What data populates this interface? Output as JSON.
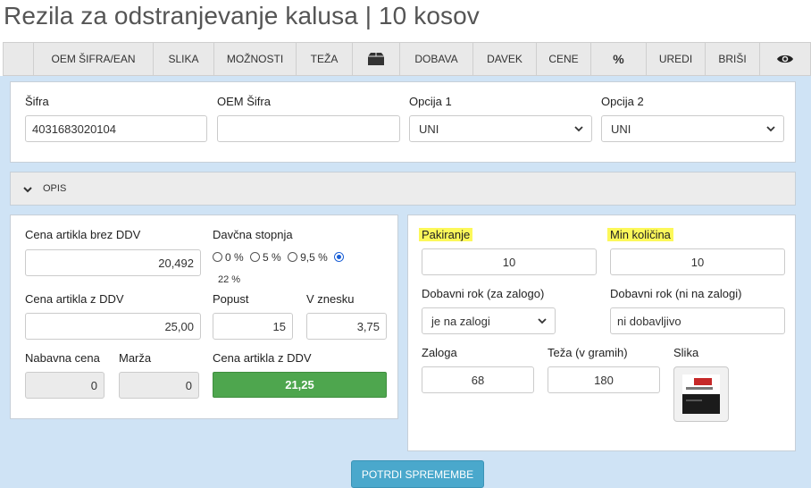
{
  "page": {
    "title": "Rezila za odstranjevanje kalusa | 10 kosov"
  },
  "toolbar": {
    "items": [
      "",
      "OEM ŠIFRA/EAN",
      "SLIKA",
      "MOŽNOSTI",
      "TEŽA",
      "box-icon",
      "DOBAVA",
      "DAVEK",
      "CENE",
      "%",
      "UREDI",
      "BRIŠI",
      "eye-icon"
    ]
  },
  "codes": {
    "sifra_label": "Šifra",
    "sifra_value": "4031683020104",
    "oem_label": "OEM Šifra",
    "oem_value": "",
    "opcija1_label": "Opcija 1",
    "opcija1_value": "UNI",
    "opcija2_label": "Opcija 2",
    "opcija2_value": "UNI"
  },
  "opis": {
    "label": "OPIS",
    "icon": "chevron-down-icon"
  },
  "pricing": {
    "cena_brez_label": "Cena artikla brez DDV",
    "cena_brez_value": "20,492",
    "davcna_label": "Davčna stopnja",
    "rates": [
      "0 %",
      "5 %",
      "9,5 %",
      ""
    ],
    "selected_rate_index": 3,
    "selected_rate_note": "22 %",
    "cena_z_label": "Cena artikla z DDV",
    "cena_z_value": "25,00",
    "popust_label": "Popust",
    "popust_value": "15",
    "v_znesku_label": "V znesku",
    "v_znesku_value": "3,75",
    "nabavna_label": "Nabavna cena",
    "nabavna_value": "0",
    "marza_label": "Marža",
    "marza_value": "0",
    "cena_final_label": "Cena artikla z DDV",
    "cena_final_value": "21,25",
    "final_color": "#4ea64e"
  },
  "stock": {
    "pakiranje_label": "Pakiranje",
    "pakiranje_value": "10",
    "min_kolicina_label": "Min količina",
    "min_kolicina_value": "10",
    "rok_zaloga_label": "Dobavni rok (za zalogo)",
    "rok_zaloga_value": "je na zalogi",
    "rok_ni_label": "Dobavni rok (ni na zalogi)",
    "rok_ni_value": "ni dobavljivo",
    "zaloga_label": "Zaloga",
    "zaloga_value": "68",
    "teza_label": "Teža (v gramih)",
    "teza_value": "180",
    "slika_label": "Slika",
    "highlight_color": "#fcf85a"
  },
  "actions": {
    "confirm_label": "POTRDI SPREMEMBE"
  }
}
